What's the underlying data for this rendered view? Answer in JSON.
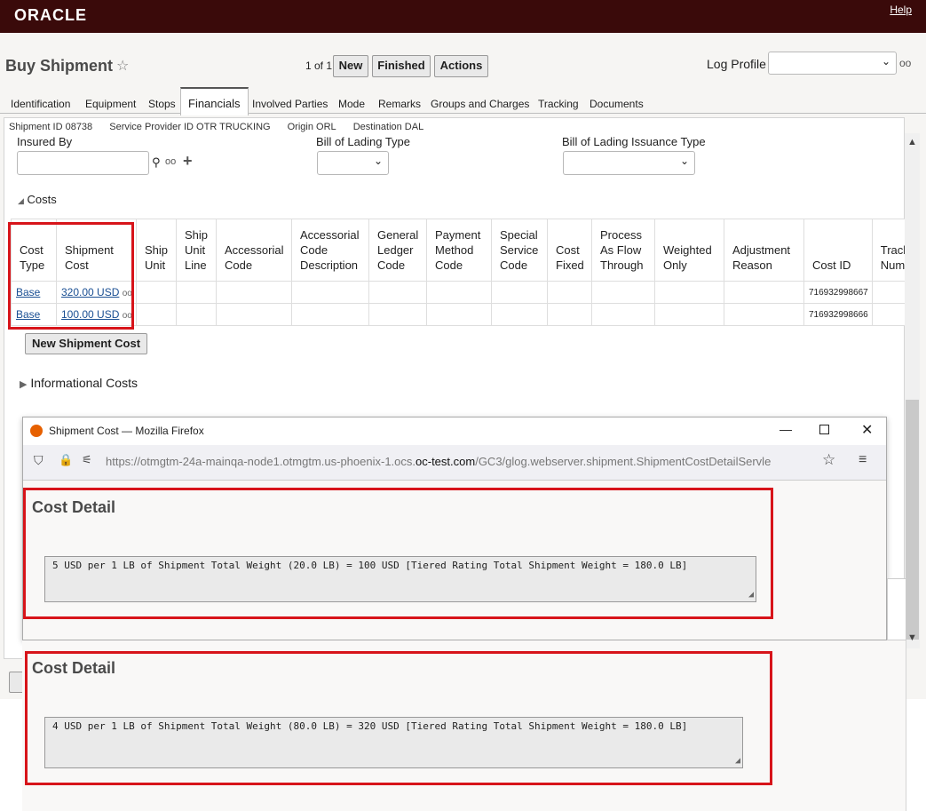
{
  "header": {
    "logo": "ORACLE",
    "help": "Help"
  },
  "title_bar": {
    "title": "Buy Shipment",
    "pager": "1 of 1",
    "buttons": {
      "new": "New",
      "finished": "Finished",
      "actions": "Actions"
    },
    "log_profile_label": "Log Profile"
  },
  "tabs": [
    "Identification",
    "Equipment",
    "Stops",
    "Financials",
    "Involved Parties",
    "Mode",
    "Remarks",
    "Groups and Charges",
    "Tracking",
    "Documents"
  ],
  "summary": {
    "shipment_id": "Shipment ID 08738",
    "service_provider": "Service Provider ID OTR TRUCKING",
    "origin": "Origin ORL",
    "destination": "Destination DAL"
  },
  "form": {
    "insured_by_label": "Insured By",
    "bol_type_label": "Bill of Lading Type",
    "bol_issuance_label": "Bill of Lading Issuance Type"
  },
  "costs": {
    "section_label": "Costs",
    "columns": [
      "Cost Type",
      "Shipment Cost",
      "Ship Unit",
      "Ship Unit Line",
      "Accessorial Code",
      "Accessorial Code Description",
      "General Ledger Code",
      "Payment Method Code",
      "Special Service Code",
      "Cost Fixed",
      "Process As Flow Through",
      "Weighted Only",
      "Adjustment Reason",
      "Cost ID",
      "Tracki Numb"
    ],
    "rows": [
      {
        "cost_type": "Base",
        "shipment_cost": "320.00 USD",
        "cost_id": "716932998667"
      },
      {
        "cost_type": "Base",
        "shipment_cost": "100.00 USD",
        "cost_id": "716932998666"
      }
    ],
    "new_button": "New Shipment Cost"
  },
  "informational_costs": "Informational Costs",
  "firefox": {
    "title": "Shipment Cost — Mozilla Firefox",
    "url_prefix": "https://otmgtm-24a-mainqa-node1.otmgtm.us-phoenix-1.ocs.",
    "url_domain": "oc-test.com",
    "url_suffix": "/GC3/glog.webserver.shipment.ShipmentCostDetailServle"
  },
  "cost_details": [
    {
      "title": "Cost Detail",
      "text": "5 USD per 1 LB of Shipment Total Weight (20.0 LB) = 100 USD [Tiered Rating Total Shipment Weight = 180.0 LB]"
    },
    {
      "title": "Cost Detail",
      "text": "4 USD per 1 LB of Shipment Total Weight (80.0 LB) = 320 USD [Tiered Rating Total Shipment Weight = 180.0 LB]"
    }
  ],
  "colors": {
    "header": "#3a0a0a",
    "highlight": "#d7141a",
    "link": "#1a4f93"
  }
}
